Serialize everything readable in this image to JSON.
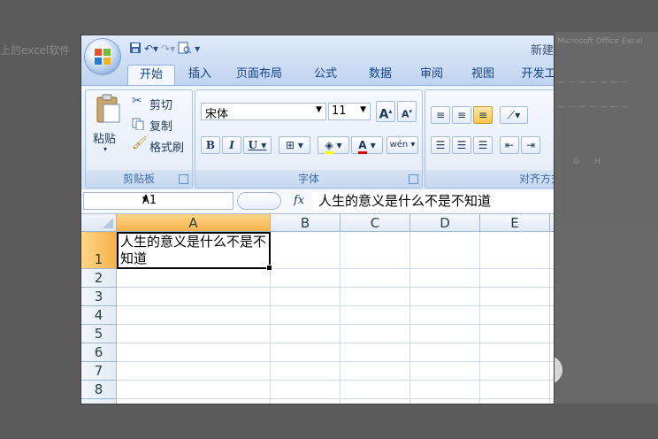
{
  "background": {
    "left_text": "上的excel软件"
  },
  "window": {
    "title_partial": "新建"
  },
  "quick_access": {
    "save_icon": "save-icon",
    "undo_icon": "undo-icon",
    "redo_icon": "redo-icon",
    "print_preview_icon": "print-preview-icon"
  },
  "tabs": [
    "开始",
    "插入",
    "页面布局",
    "公式",
    "数据",
    "审阅",
    "视图",
    "开发工"
  ],
  "clipboard": {
    "paste_label": "粘贴",
    "cut_label": "剪切",
    "copy_label": "复制",
    "format_painter_label": "格式刷",
    "group_label": "剪贴板"
  },
  "font": {
    "name": "宋体",
    "size": "11",
    "bold": "B",
    "italic": "I",
    "underline": "U",
    "grow": "A",
    "shrink": "A",
    "font_color_letter": "A",
    "phonetic": "wén",
    "group_label": "字体",
    "font_color": "#e00000",
    "fill_color": "#ffff00"
  },
  "alignment": {
    "group_label": "对齐方式"
  },
  "formula_bar": {
    "name_box": "A1",
    "fx": "fx",
    "formula": "人生的意义是什么不是不知道"
  },
  "columns": [
    "A",
    "B",
    "C",
    "D",
    "E"
  ],
  "rows": [
    "1",
    "2",
    "3",
    "4",
    "5",
    "6",
    "7",
    "8"
  ],
  "cells": {
    "A1": "人生的意义是什么不是不知道"
  },
  "colors": {
    "selection_header": "#f7b24a",
    "ribbon_blue": "#15428b"
  }
}
